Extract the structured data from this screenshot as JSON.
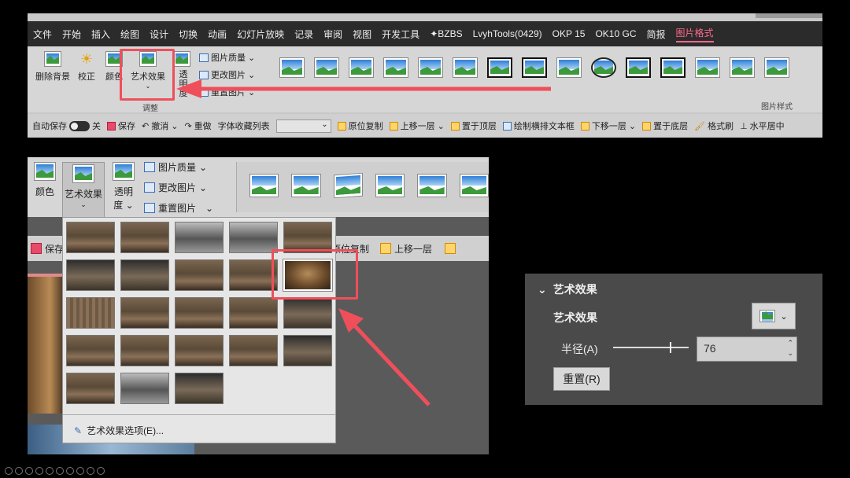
{
  "ribbon": {
    "tabs": [
      "文件",
      "开始",
      "插入",
      "绘图",
      "设计",
      "切换",
      "动画",
      "幻灯片放映",
      "记录",
      "审阅",
      "视图",
      "开发工具",
      "✦BZBS",
      "LvyhTools(0429)",
      "OKP 15",
      "OK10 GC",
      "简报",
      "图片格式"
    ],
    "active_tab": "图片格式",
    "buttons": {
      "remove_bg": "删除背景",
      "correct": "校正",
      "color": "颜色",
      "art_effect": "艺术效果",
      "transparency": "透明度",
      "quality": "图片质量",
      "change": "更改图片",
      "reset": "重置图片"
    },
    "group_adjust": "调整",
    "group_styles": "图片样式",
    "qat": {
      "autosave": "自动保存",
      "autosave_state": "关",
      "save": "保存",
      "undo": "撤消",
      "redo": "重做",
      "font_list": "字体收藏列表",
      "copy_in_place": "原位复制",
      "bring_forward": "上移一层",
      "bring_front": "置于顶层",
      "draw_textbox": "绘制横排文本框",
      "send_backward": "下移一层",
      "send_back": "置于底层",
      "format_painter": "格式刷",
      "center_h": "水平居中"
    }
  },
  "zoom": {
    "color": "颜色",
    "art_effect": "艺术效果",
    "transparency_line1": "透明",
    "transparency_line2": "度",
    "quality": "图片质量",
    "change": "更改图片",
    "reset": "重置图片",
    "save": "保存",
    "copy_in_place": "原位复制",
    "bring_forward": "上移一层",
    "options": "艺术效果选项(E)..."
  },
  "pane": {
    "section": "艺术效果",
    "art_effect_label": "艺术效果",
    "radius_label": "半径(A)",
    "radius_value": "76",
    "reset_button": "重置(R)"
  },
  "colors": {
    "highlight": "#ef4f5a",
    "active_tab": "#ff6a8a"
  }
}
